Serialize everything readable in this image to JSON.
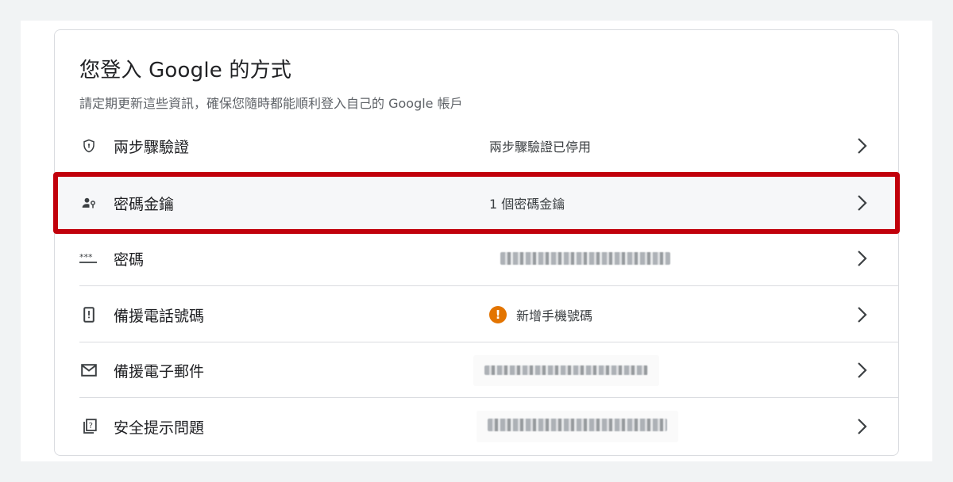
{
  "section": {
    "title": "您登入 Google 的方式",
    "subtitle": "請定期更新這些資訊，確保您隨時都能順利登入自己的 Google 帳戶"
  },
  "rows": [
    {
      "label": "兩步驟驗證",
      "value": "兩步驟驗證已停用",
      "icon": "shield-icon"
    },
    {
      "label": "密碼金鑰",
      "value": "1 個密碼金鑰",
      "icon": "passkey-icon"
    },
    {
      "label": "密碼",
      "value": "",
      "icon": "password-dots-icon"
    },
    {
      "label": "備援電話號碼",
      "value": "新增手機號碼",
      "icon": "phone-icon",
      "badge": "!"
    },
    {
      "label": "備援電子郵件",
      "value": "",
      "icon": "mail-icon"
    },
    {
      "label": "安全提示問題",
      "value": "",
      "icon": "security-question-icon"
    }
  ],
  "colors": {
    "highlight_frame": "#c1000b",
    "warning": "#e37400"
  }
}
